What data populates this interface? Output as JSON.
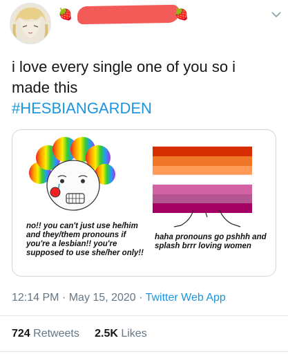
{
  "tweet": {
    "text_line1": "i love every single one of you so i",
    "text_line2": "made this",
    "hashtag": "#HESBIANGARDEN",
    "time": "12:14 PM",
    "date": "May 15, 2020",
    "app": "Twitter Web App",
    "separator": "·"
  },
  "header": {
    "strawberry_emoji": "🍓",
    "icons": [
      "avatar",
      "chevron-down-icon"
    ],
    "redaction_color": "#f25b58"
  },
  "image": {
    "caption_left": "no!! you can't just use he/him and they/them pronouns if you're a lesbian!! you're supposed to use she/her only!!",
    "caption_right": "haha pronouns go pshhh and splash brrr loving women",
    "flag_colors": [
      "#d52d00",
      "#ef7627",
      "#ff9a56",
      "#ffffff",
      "#d162a4",
      "#b55690",
      "#a30262"
    ]
  },
  "stats": {
    "retweets_count": "724",
    "retweets_label": "Retweets",
    "likes_count": "2.5K",
    "likes_label": "Likes"
  },
  "colors": {
    "accent": "#1b95e0",
    "meta": "#657786",
    "text": "#14171a"
  }
}
